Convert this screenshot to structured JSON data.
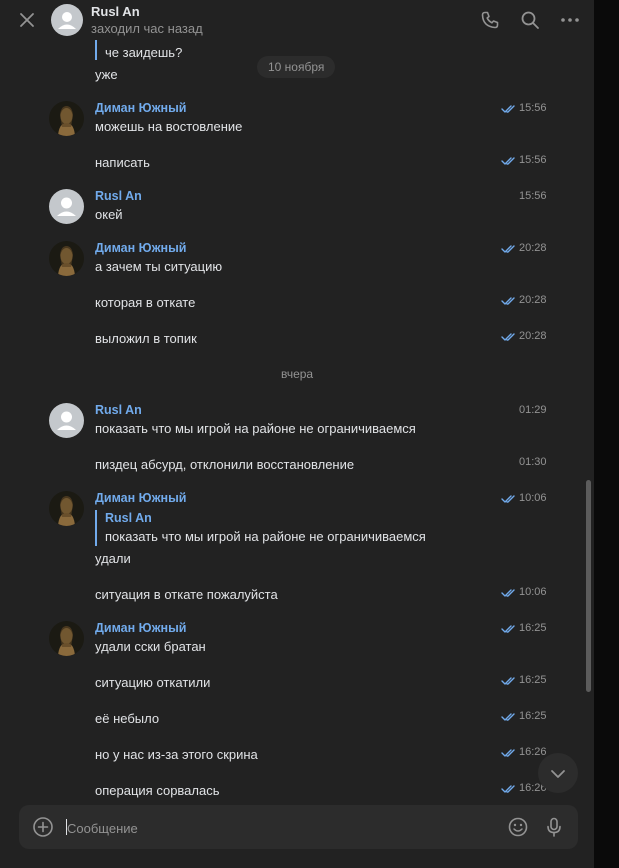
{
  "header": {
    "contact_name": "Rusl An",
    "status": "заходил час назад"
  },
  "conversation": {
    "quoted_top_line": "че заидешь?",
    "top_message": "уже",
    "date_separator_1": "10 ноября",
    "date_separator_2": "вчера",
    "messages": [
      {
        "author": "Диман Южный",
        "text": "можешь на востовление",
        "time": "15:56",
        "read": true
      },
      {
        "author": "",
        "text": "написать",
        "time": "15:56",
        "read": true
      },
      {
        "author": "Rusl An",
        "text": "окей",
        "time": "15:56",
        "read": false
      },
      {
        "author": "Диман Южный",
        "text": "а зачем ты ситуацию",
        "time": "20:28",
        "read": true
      },
      {
        "author": "",
        "text": "которая в откате",
        "time": "20:28",
        "read": true
      },
      {
        "author": "",
        "text": "выложил в топик",
        "time": "20:28",
        "read": true
      },
      {
        "author": "Rusl An",
        "text": "показать что мы игрой на районе не ограничиваемся",
        "time": "01:29",
        "read": false
      },
      {
        "author": "",
        "text": "пиздец абсурд, отклонили восстановление",
        "time": "01:30",
        "read": false
      },
      {
        "author": "Диман Южный",
        "reply_author": "Rusl An",
        "reply_text": "показать что мы игрой на районе не ограничиваемся",
        "text": "удали",
        "time": "10:06",
        "read": true
      },
      {
        "author": "",
        "text": "ситуация в откате пожалуйста",
        "time": "10:06",
        "read": true
      },
      {
        "author": "Диман Южный",
        "text": "удали сски братан",
        "time": "16:25",
        "read": true
      },
      {
        "author": "",
        "text": "ситуацию откатили",
        "time": "16:25",
        "read": true
      },
      {
        "author": "",
        "text": "её небыло",
        "time": "16:25",
        "read": true
      },
      {
        "author": "",
        "text": "но у нас из-за этого скрина",
        "time": "16:26",
        "read": true
      },
      {
        "author": "",
        "text": "операция сорвалась",
        "time": "16:26",
        "read": true
      }
    ]
  },
  "composer": {
    "placeholder": "Сообщение"
  },
  "colors": {
    "background": "#222222",
    "accent": "#71aaeb",
    "secondary_text": "#939393",
    "primary_text": "#e1e3e6",
    "input_background": "#2c2c2c"
  },
  "icons": [
    "close-icon",
    "phone-icon",
    "search-icon",
    "more-icon",
    "add-attachment-icon",
    "emoji-icon",
    "microphone-icon",
    "chevron-down-icon",
    "double-check-icon"
  ]
}
